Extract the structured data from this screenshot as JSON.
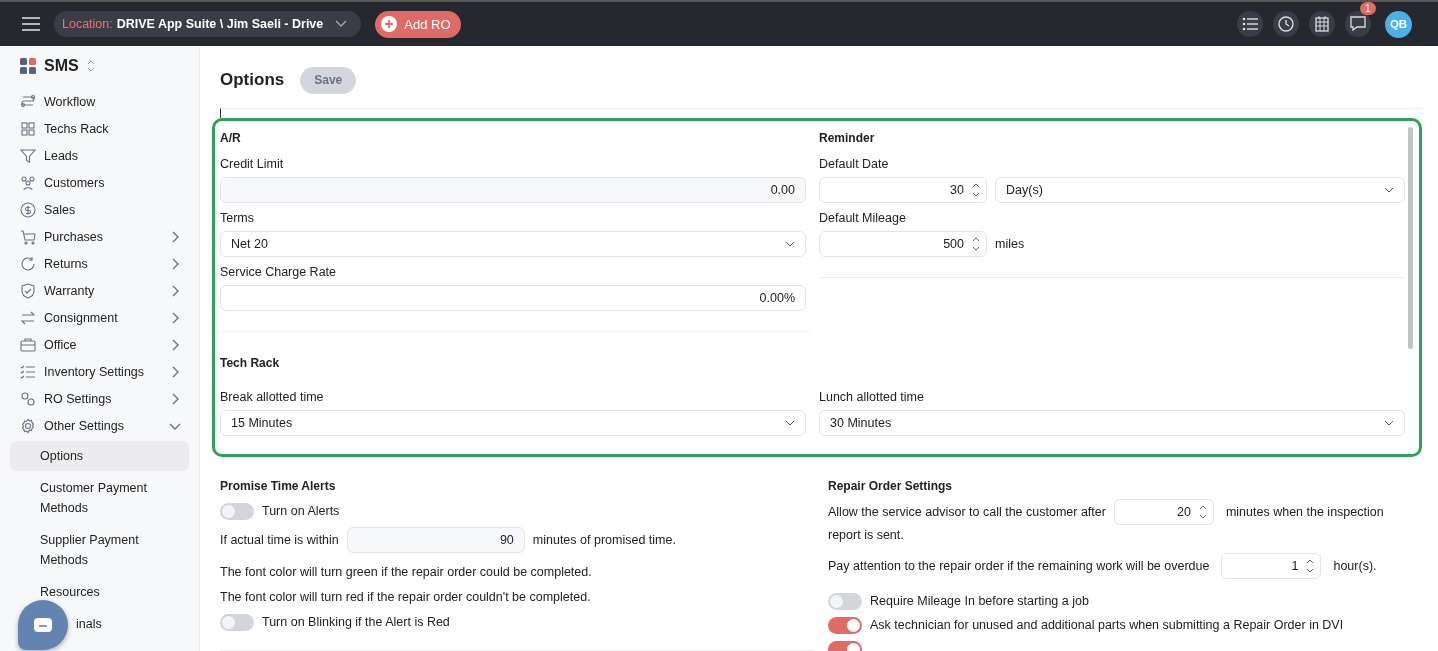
{
  "topbar": {
    "location_label": "Location:",
    "location_value": "DRIVE App Suite \\ Jim Saeli - Drive",
    "add_ro": "Add RO",
    "notification_count": "1",
    "avatar": "QB"
  },
  "sidebar": {
    "brand": "SMS",
    "items": [
      {
        "label": "Workflow",
        "kind": "link",
        "selected": false
      },
      {
        "label": "Techs Rack",
        "kind": "link",
        "selected": false
      },
      {
        "label": "Leads",
        "kind": "link",
        "selected": false
      },
      {
        "label": "Customers",
        "kind": "link",
        "selected": false
      },
      {
        "label": "Sales",
        "kind": "link",
        "selected": false
      },
      {
        "label": "Purchases",
        "kind": "group",
        "expanded": false,
        "selected": false
      },
      {
        "label": "Returns",
        "kind": "group",
        "expanded": false,
        "selected": false
      },
      {
        "label": "Warranty",
        "kind": "group",
        "expanded": false,
        "selected": false
      },
      {
        "label": "Consignment",
        "kind": "group",
        "expanded": false,
        "selected": false
      },
      {
        "label": "Office",
        "kind": "group",
        "expanded": false,
        "selected": false
      },
      {
        "label": "Inventory Settings",
        "kind": "group",
        "expanded": false,
        "selected": false
      },
      {
        "label": "RO Settings",
        "kind": "group",
        "expanded": false,
        "selected": false
      },
      {
        "label": "Other Settings",
        "kind": "group",
        "expanded": true,
        "selected": false,
        "children": [
          {
            "label": "Options",
            "selected": true
          },
          {
            "label": "Customer Payment Methods",
            "selected": false
          },
          {
            "label": "Supplier Payment Methods",
            "selected": false
          },
          {
            "label": "Resources",
            "selected": false
          },
          {
            "label": "inals",
            "selected": false
          }
        ]
      }
    ]
  },
  "page": {
    "title": "Options",
    "save": {
      "label": "Save",
      "disabled": true
    }
  },
  "ar": {
    "heading": "A/R",
    "credit_limit": {
      "label": "Credit Limit",
      "value": "0.00"
    },
    "terms": {
      "label": "Terms",
      "value": "Net 20"
    },
    "service_charge": {
      "label": "Service Charge Rate",
      "value": "0.00%"
    }
  },
  "reminder": {
    "heading": "Reminder",
    "default_date": {
      "label": "Default Date",
      "value": "30",
      "unit": "Day(s)"
    },
    "default_mileage": {
      "label": "Default Mileage",
      "value": "500",
      "unit": "miles"
    }
  },
  "tech_rack": {
    "heading": "Tech Rack",
    "break": {
      "label": "Break allotted time",
      "value": "15 Minutes"
    },
    "lunch": {
      "label": "Lunch allotted time",
      "value": "30 Minutes"
    }
  },
  "promise": {
    "heading": "Promise Time Alerts",
    "alerts": {
      "label": "Turn on Alerts",
      "on": false
    },
    "within_before": "If actual time is within",
    "within_value": "90",
    "within_after": "minutes of promised time.",
    "notes": [
      "The font color will turn green if the repair order could be completed.",
      "The font color will turn red if the repair order couldn't be completed."
    ],
    "blinking": {
      "label": "Turn on Blinking if the Alert is Red",
      "on": false
    }
  },
  "repair": {
    "heading": "Repair Order Settings",
    "call_before": "Allow the service advisor to call the customer after",
    "call_value": "20",
    "call_after": "minutes when the inspection",
    "call_after_wrap": "report is sent.",
    "overdue_before": "Pay attention to the repair order if the remaining work will be overdue",
    "overdue_value": "1",
    "overdue_after": "hour(s).",
    "toggles": [
      {
        "label": "Require Mileage In before starting a job",
        "on": false
      },
      {
        "label": "Ask technician for unused and additional parts when submitting a Repair Order in DVI",
        "on": true
      },
      {
        "on": true
      }
    ]
  }
}
